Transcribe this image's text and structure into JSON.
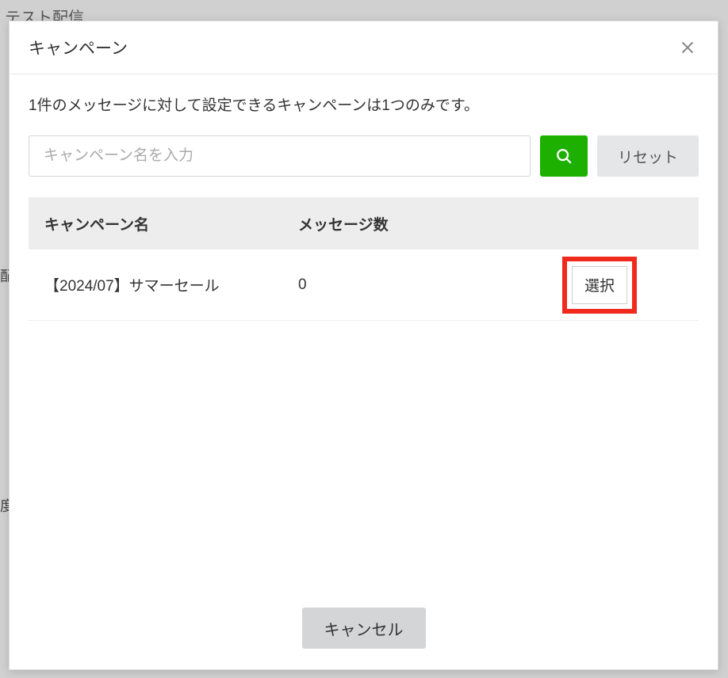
{
  "background": {
    "tab_label": "テスト配信",
    "truncated_1": "配",
    "truncated_2": "度"
  },
  "modal": {
    "title": "キャンペーン",
    "info_text": "1件のメッセージに対して設定できるキャンペーンは1つのみです。",
    "search": {
      "placeholder": "キャンペーン名を入力"
    },
    "reset_label": "リセット",
    "table": {
      "headers": {
        "name": "キャンペーン名",
        "count": "メッセージ数"
      },
      "rows": [
        {
          "name": "【2024/07】サマーセール",
          "count": "0",
          "action_label": "選択"
        }
      ]
    },
    "cancel_label": "キャンセル"
  }
}
